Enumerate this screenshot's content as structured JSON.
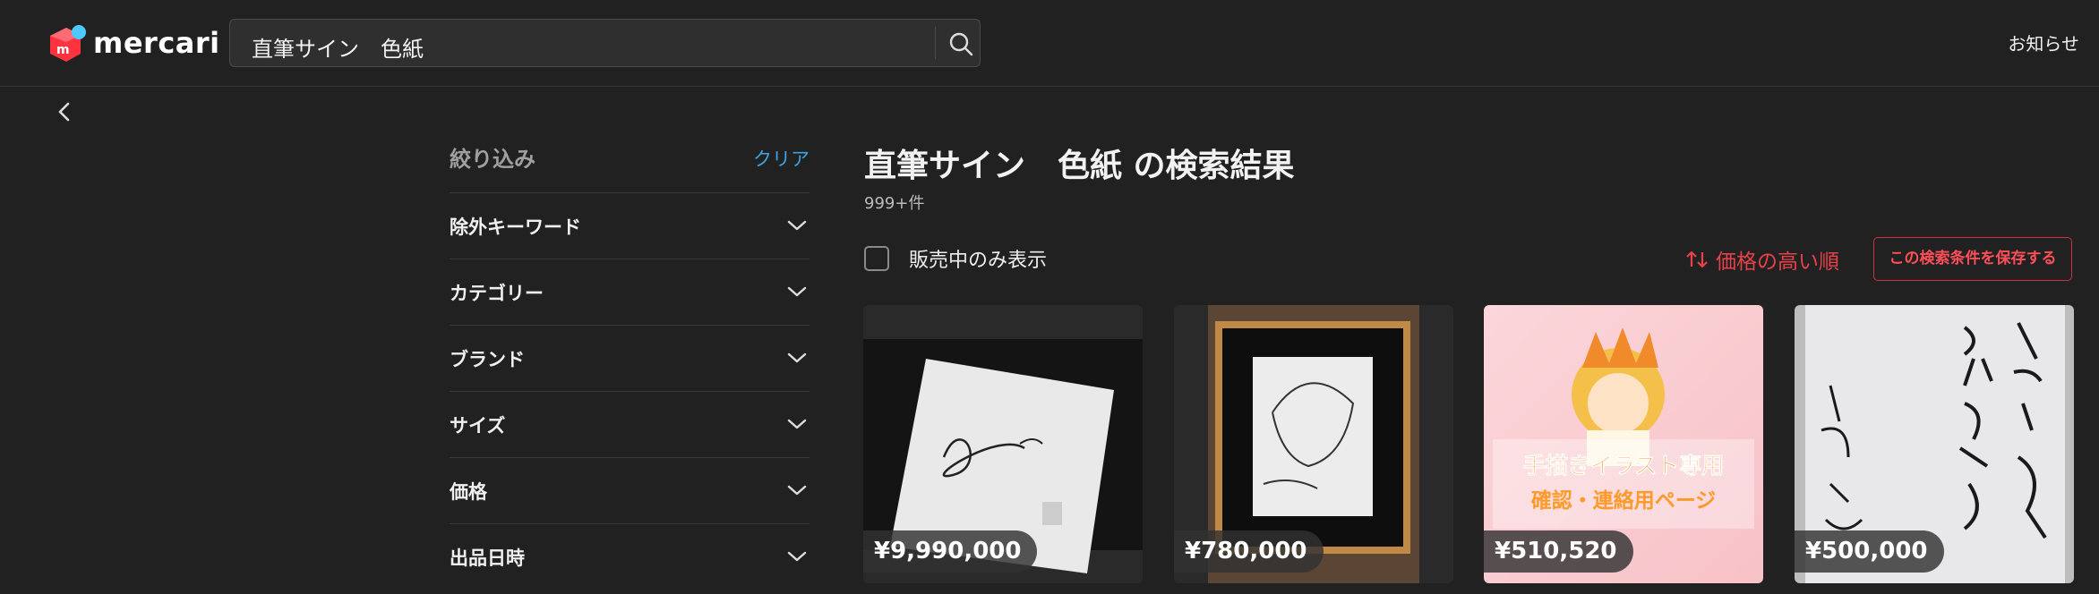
{
  "header": {
    "brand": "mercari",
    "search_value": "直筆サイン　色紙",
    "notice_label": "お知らせ"
  },
  "sidebar": {
    "title": "絞り込み",
    "clear_label": "クリア",
    "filters": [
      {
        "label": "除外キーワード"
      },
      {
        "label": "カテゴリー"
      },
      {
        "label": "ブランド"
      },
      {
        "label": "サイズ"
      },
      {
        "label": "価格"
      },
      {
        "label": "出品日時"
      }
    ]
  },
  "main": {
    "title": "直筆サイン　色紙 の検索結果",
    "count": "999+件",
    "on_sale_label": "販売中のみ表示",
    "sort_label": "価格の高い順",
    "save_label": "この検索条件を保存する"
  },
  "products": [
    {
      "price": "¥9,990,000",
      "thumb": "white-autograph-board"
    },
    {
      "price": "¥780,000",
      "thumb": "framed-manga-sketch"
    },
    {
      "price": "¥510,520",
      "thumb": "hand-drawn-illustration",
      "overlay_line1": "手描きイラスト専用",
      "overlay_line2": "確認・連絡用ページ"
    },
    {
      "price": "¥500,000",
      "thumb": "calligraphy-board"
    }
  ],
  "colors": {
    "background": "#212121",
    "accent_red": "#e8414a",
    "link_blue": "#3ea3e0",
    "brand_red": "#ff333f",
    "brand_blue": "#4dc9ff"
  }
}
